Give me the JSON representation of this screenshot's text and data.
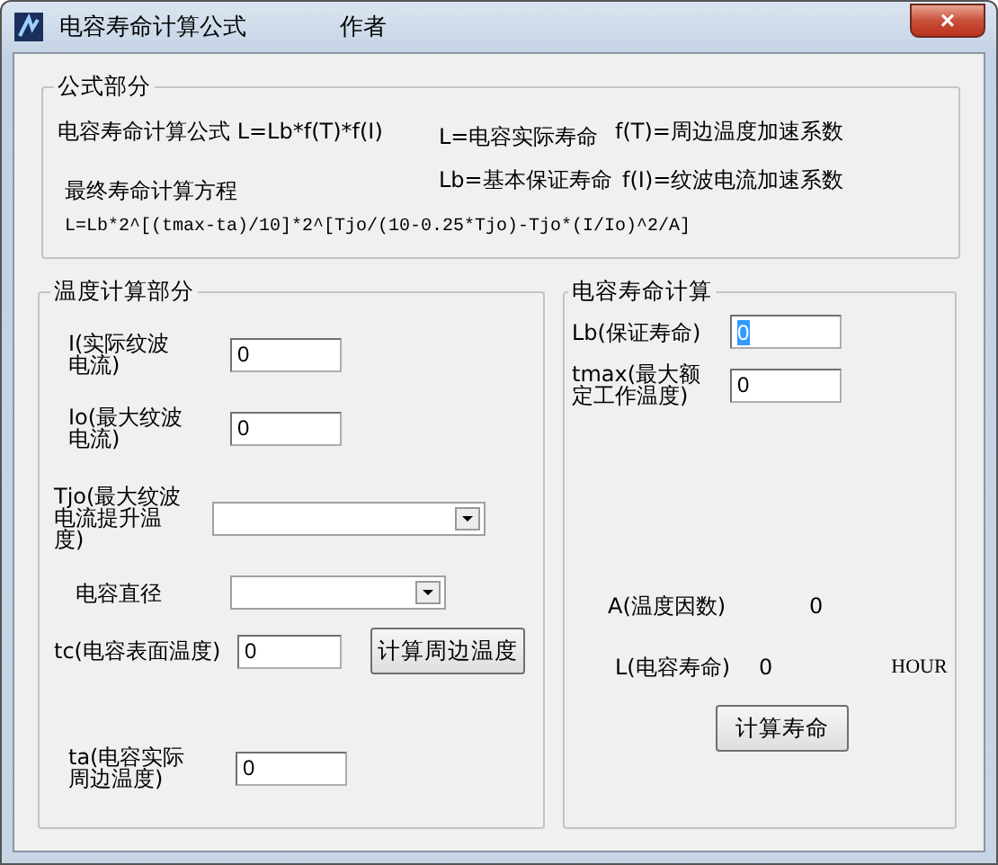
{
  "window": {
    "title": "电容寿命计算公式",
    "author": "作者",
    "close": "×"
  },
  "formula_section": {
    "title": "公式部分",
    "formula_label": "电容寿命计算公式 L=Lb*f(T)*f(I)",
    "definitions": [
      "L=电容实际寿命",
      "f(T)=周边温度加速系数",
      "Lb=基本保证寿命",
      "f(I)=纹波电流加速系数"
    ],
    "equation_label": "最终寿命计算方程",
    "equation": "L=Lb*2^[(tmax-ta)/10]*2^[Tjo/(10-0.25*Tjo)-Tjo*(I/Io)^2/A]"
  },
  "temperature_section": {
    "title": "温度计算部分",
    "fields": [
      {
        "kind": "input",
        "label": "I(实际纹波电流)",
        "value": "0"
      },
      {
        "kind": "input",
        "label": "Io(最大纹波电流)",
        "value": "0"
      },
      {
        "kind": "select",
        "label": "Tjo(最大纹波电流提升温度)"
      },
      {
        "kind": "select",
        "label": "电容直径"
      },
      {
        "kind": "input",
        "label": "tc(电容表面温度)",
        "value": "0",
        "button": "计算周边温度"
      },
      {
        "kind": "input",
        "label": "ta(电容实际周边温度)",
        "value": "0"
      }
    ]
  },
  "life_section": {
    "title": "电容寿命计算",
    "fields": [
      {
        "label": "Lb(保证寿命)",
        "value": "0",
        "focused": true
      },
      {
        "label": "tmax(最大额定工作温度)",
        "value": "0",
        "focused": false
      }
    ],
    "results": [
      {
        "label": "A(温度因数)",
        "value": "0"
      },
      {
        "label": "L(电容寿命)",
        "value": "0",
        "unit": "HOUR"
      }
    ],
    "button": "计算寿命"
  }
}
